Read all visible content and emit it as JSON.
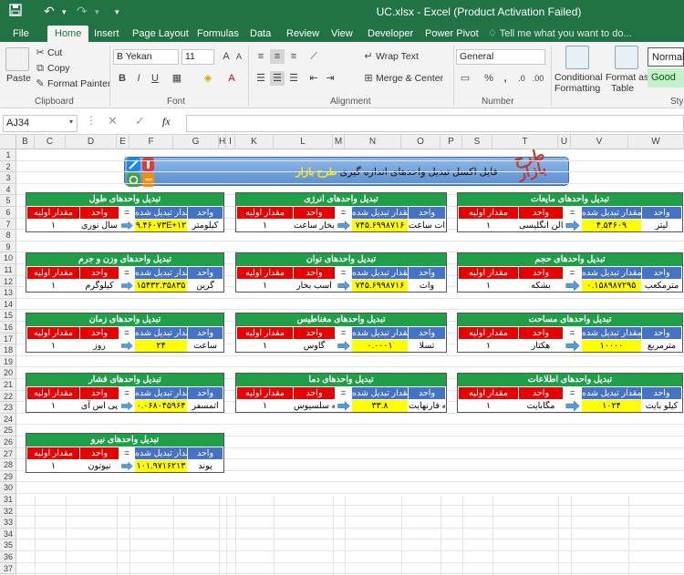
{
  "window": {
    "title": "UC.xlsx  -  Excel (Product Activation Failed)"
  },
  "colors": {
    "accent": "#217346",
    "table_header": "#1fa048",
    "unit_header": "#4472c4",
    "input_header": "#e60000",
    "result_fill": "#ffff00"
  },
  "tabs": [
    "File",
    "Home",
    "Insert",
    "Page Layout",
    "Formulas",
    "Data",
    "Review",
    "View",
    "Developer",
    "Power Pivot"
  ],
  "tell_me": "Tell me what you want to do...",
  "ribbon": {
    "clipboard": {
      "paste": "Paste",
      "cut": "Cut",
      "copy": "Copy",
      "format_painter": "Format Painter",
      "label": "Clipboard"
    },
    "font": {
      "name": "B Yekan",
      "size": "11",
      "label": "Font",
      "bold": "B",
      "italic": "I",
      "underline": "U"
    },
    "alignment": {
      "wrap_text": "Wrap Text",
      "merge_center": "Merge & Center",
      "label": "Alignment"
    },
    "number": {
      "format": "General",
      "label": "Number",
      "percent": "%",
      "comma": ","
    },
    "styles": {
      "conditional": "Conditional",
      "formatting": "Formatting",
      "format_as": "Format as",
      "table": "Table",
      "normal": "Normal",
      "good": "Good",
      "label": "Sty"
    }
  },
  "formula_bar": {
    "name_box": "AJ34",
    "fx": "fx",
    "value": ""
  },
  "columns": [
    "B",
    "C",
    "D",
    "E",
    "F",
    "G",
    "H",
    "I",
    "K",
    "L",
    "M",
    "N",
    "O",
    "P",
    "S",
    "T",
    "U",
    "V",
    "W"
  ],
  "rows": [
    "1",
    "2",
    "3",
    "4",
    "5",
    "6",
    "7",
    "8",
    "9",
    "10",
    "11",
    "12",
    "13",
    "14",
    "15",
    "16",
    "17",
    "18",
    "19",
    "20",
    "21",
    "22",
    "23",
    "24",
    "25",
    "26",
    "27",
    "28",
    "29",
    "30",
    "31",
    "32",
    "33",
    "34",
    "35",
    "36",
    "37"
  ],
  "banner": {
    "text_prefix": "فایل اکسل تبدیل واحدهای اندازه گیری",
    "text_brand": "طرح بازار",
    "logo": "طرح بازار"
  },
  "header_labels": {
    "unit": "واحد",
    "converted": "مقدار تبدیل شده",
    "eq": "=",
    "unit2": "واحد",
    "initial": "مقدار اولیه"
  },
  "tables": [
    {
      "title": "تبدیل واحدهای طول",
      "to_unit": "کیلومتر",
      "result": "۹.۴۶۰۷۳E+۱۲",
      "from_unit": "سال نوری",
      "input": "۱"
    },
    {
      "title": "تبدیل واحدهای انرژی",
      "to_unit": "وات ساعت",
      "result": "۷۴۵.۶۹۹۸۷۱۶",
      "from_unit": "اسب بخار ساعت",
      "input": "۱"
    },
    {
      "title": "تبدیل واحدهای مایعات",
      "to_unit": "لیتر",
      "result": "۴.۵۴۶۰۹",
      "from_unit": "گالن انگلیسی",
      "input": "۱"
    },
    {
      "title": "تبدیل واحدهای وزن و جرم",
      "to_unit": "گرین",
      "result": "۱۵۴۳۲.۳۵۸۳۵",
      "from_unit": "کیلوگرم",
      "input": "۱"
    },
    {
      "title": "تبدیل واحدهای توان",
      "to_unit": "وات",
      "result": "۷۴۵.۶۹۹۸۷۱۶",
      "from_unit": "اسب بخار",
      "input": "۱"
    },
    {
      "title": "تبدیل واحدهای حجم",
      "to_unit": "مترمکعب",
      "result": "۰.۱۵۸۹۸۷۲۹۵",
      "from_unit": "بشکه",
      "input": "۱"
    },
    {
      "title": "تبدیل واحدهای زمان",
      "to_unit": "ساعت",
      "result": "۲۴",
      "from_unit": "روز",
      "input": "۱"
    },
    {
      "title": "تبدیل واحدهای مغناطیس",
      "to_unit": "تسلا",
      "result": "۰.۰۰۰۱",
      "from_unit": "گاوس",
      "input": "۱"
    },
    {
      "title": "تبدیل واحدهای مساحت",
      "to_unit": "مترمربع",
      "result": "۱۰۰۰۰",
      "from_unit": "هکتار",
      "input": "۱"
    },
    {
      "title": "تبدیل واحدهای فشار",
      "to_unit": "اتمسفر",
      "result": "۰.۰۶۸۰۴۵۹۶۴",
      "from_unit": "پی اس آی",
      "input": "۱"
    },
    {
      "title": "تبدیل واحدهای دما",
      "to_unit": "درجه فارنهایت",
      "result": "۳۳.۸",
      "from_unit": "درجه سلسیوس",
      "input": "۱"
    },
    {
      "title": "تبدیل واحدهای اطلاعات",
      "to_unit": "کیلو بایت",
      "result": "۱۰۲۴",
      "from_unit": "مگابایت",
      "input": "۱"
    },
    {
      "title": "تبدیل واحدهای نیرو",
      "to_unit": "پوند",
      "result": "۱۰۱.۹۷۱۶۲۱۳",
      "from_unit": "نیوتون",
      "input": "۱"
    }
  ]
}
